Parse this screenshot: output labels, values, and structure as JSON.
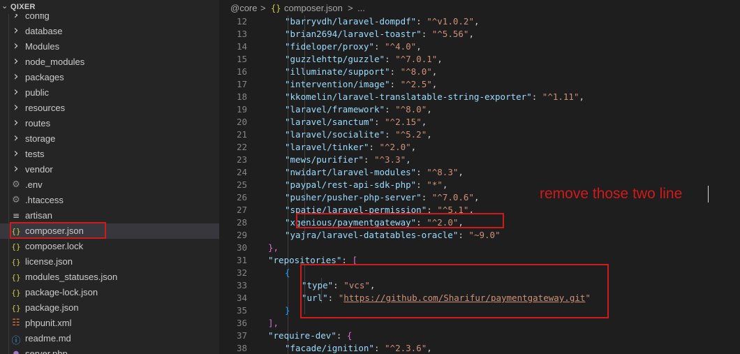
{
  "explorer": {
    "title": "QIXER",
    "items": [
      {
        "label": "config",
        "icon": "chevron-right-icon",
        "kind": "folder"
      },
      {
        "label": "database",
        "icon": "chevron-right-icon",
        "kind": "folder"
      },
      {
        "label": "Modules",
        "icon": "chevron-right-icon",
        "kind": "folder"
      },
      {
        "label": "node_modules",
        "icon": "chevron-right-icon",
        "kind": "folder"
      },
      {
        "label": "packages",
        "icon": "chevron-right-icon",
        "kind": "folder"
      },
      {
        "label": "public",
        "icon": "chevron-right-icon",
        "kind": "folder"
      },
      {
        "label": "resources",
        "icon": "chevron-right-icon",
        "kind": "folder"
      },
      {
        "label": "routes",
        "icon": "chevron-right-icon",
        "kind": "folder"
      },
      {
        "label": "storage",
        "icon": "chevron-right-icon",
        "kind": "folder"
      },
      {
        "label": "tests",
        "icon": "chevron-right-icon",
        "kind": "folder"
      },
      {
        "label": "vendor",
        "icon": "chevron-right-icon",
        "kind": "folder"
      },
      {
        "label": ".env",
        "icon": "gear-icon",
        "kind": "file"
      },
      {
        "label": ".htaccess",
        "icon": "gear-icon",
        "kind": "file"
      },
      {
        "label": "artisan",
        "icon": "lines-icon",
        "kind": "file"
      },
      {
        "label": "composer.json",
        "icon": "json-icon",
        "kind": "file",
        "active": true
      },
      {
        "label": "composer.lock",
        "icon": "json-icon",
        "kind": "file"
      },
      {
        "label": "license.json",
        "icon": "json-icon",
        "kind": "file"
      },
      {
        "label": "modules_statuses.json",
        "icon": "json-icon",
        "kind": "file"
      },
      {
        "label": "package-lock.json",
        "icon": "json-icon",
        "kind": "file"
      },
      {
        "label": "package.json",
        "icon": "json-icon",
        "kind": "file"
      },
      {
        "label": "phpunit.xml",
        "icon": "xml-icon",
        "kind": "file"
      },
      {
        "label": "readme.md",
        "icon": "info-icon",
        "kind": "file"
      },
      {
        "label": "server.php",
        "icon": "php-icon",
        "kind": "file"
      }
    ]
  },
  "breadcrumb": {
    "folder": "@core",
    "sep1": ">",
    "json_icon": "{}",
    "file": "composer.json",
    "sep2": ">",
    "more": "..."
  },
  "code": {
    "lines": [
      {
        "n": "12",
        "key": "barryvdh/laravel-dompdf",
        "val": "^v1.0.2"
      },
      {
        "n": "13",
        "key": "brian2694/laravel-toastr",
        "val": "^5.56"
      },
      {
        "n": "14",
        "key": "fideloper/proxy",
        "val": "^4.0"
      },
      {
        "n": "15",
        "key": "guzzlehttp/guzzle",
        "val": "^7.0.1"
      },
      {
        "n": "16",
        "key": "illuminate/support",
        "val": "^8.0"
      },
      {
        "n": "17",
        "key": "intervention/image",
        "val": "^2.5"
      },
      {
        "n": "18",
        "key": "kkomelin/laravel-translatable-string-exporter",
        "val": "^1.11"
      },
      {
        "n": "19",
        "key": "laravel/framework",
        "val": "^8.0"
      },
      {
        "n": "20",
        "key": "laravel/sanctum",
        "val": "^2.15"
      },
      {
        "n": "21",
        "key": "laravel/socialite",
        "val": "^5.2"
      },
      {
        "n": "22",
        "key": "laravel/tinker",
        "val": "^2.0"
      },
      {
        "n": "23",
        "key": "mews/purifier",
        "val": "^3.3"
      },
      {
        "n": "24",
        "key": "nwidart/laravel-modules",
        "val": "^8.3"
      },
      {
        "n": "25",
        "key": "paypal/rest-api-sdk-php",
        "val": "*"
      },
      {
        "n": "26",
        "key": "pusher/pusher-php-server",
        "val": "^7.0.6"
      },
      {
        "n": "27",
        "key": "spatie/laravel-permission",
        "val": "^5.1"
      },
      {
        "n": "28",
        "key": "xgenious/paymentgateway",
        "val": "^2.0"
      },
      {
        "n": "29",
        "key": "yajra/laravel-datatables-oracle",
        "val": "~9.0"
      },
      {
        "n": "30",
        "text": "},"
      },
      {
        "n": "31",
        "key": "repositories",
        "text": "["
      },
      {
        "n": "32",
        "text": "{"
      },
      {
        "n": "33",
        "key": "type",
        "val": "vcs"
      },
      {
        "n": "34",
        "key": "url",
        "val": "https://github.com/Sharifur/paymentgateway.git"
      },
      {
        "n": "35",
        "text": "}"
      },
      {
        "n": "36",
        "text": "],"
      },
      {
        "n": "37",
        "key": "require-dev",
        "text": "{"
      },
      {
        "n": "38",
        "key": "facade/ignition",
        "val": "^2.3.6"
      }
    ]
  },
  "annotation": {
    "note": "remove those two line"
  },
  "colors": {
    "highlight_box": "#d11a1a",
    "json_key": "#9cdcfe",
    "json_string": "#ce9178"
  }
}
